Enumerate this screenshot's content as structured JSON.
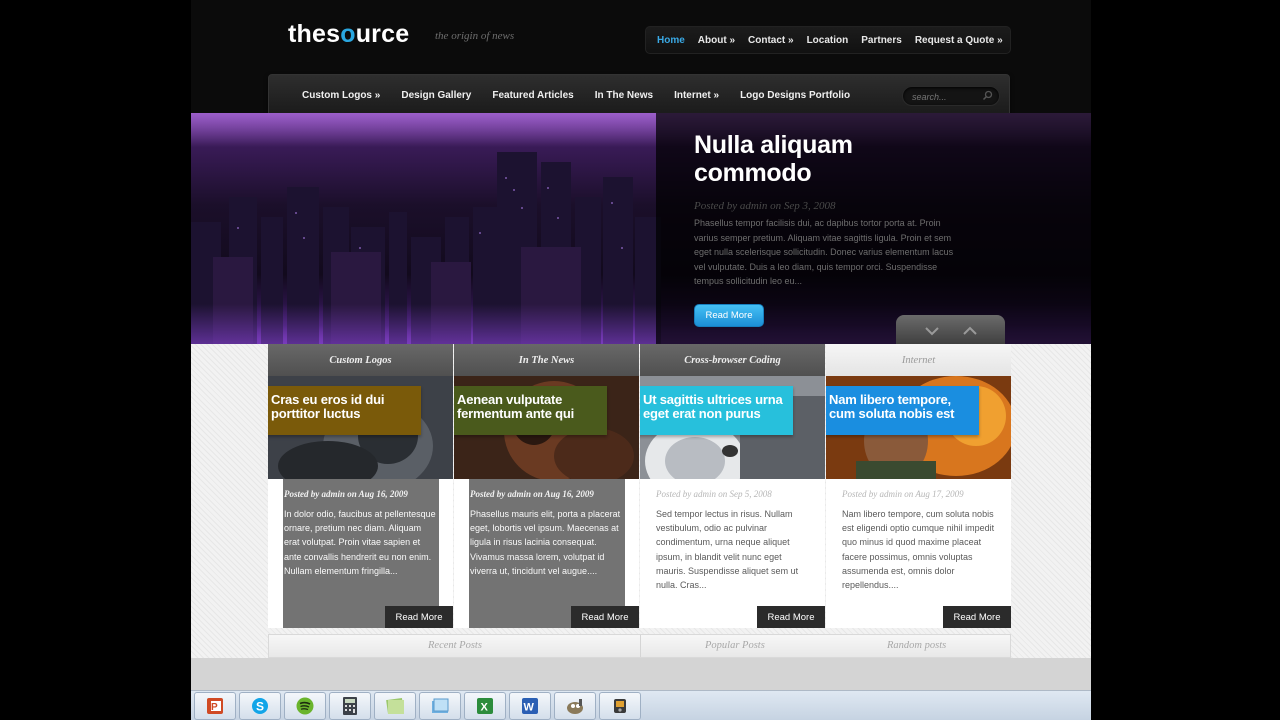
{
  "header": {
    "logo_pre": "thes",
    "logo_o": "o",
    "logo_post": "urce",
    "tagline": "the origin of news",
    "top_nav": [
      "Home",
      "About »",
      "Contact »",
      "Location",
      "Partners",
      "Request a Quote »"
    ],
    "main_nav": [
      "Custom Logos »",
      "Design Gallery",
      "Featured Articles",
      "In The News",
      "Internet »",
      "Logo Designs Portfolio"
    ],
    "search_placeholder": "search..."
  },
  "featured": {
    "title": "Nulla aliquam commodo",
    "meta": "Posted by admin on Sep 3, 2008",
    "excerpt": "Phasellus tempor facilisis dui, ac dapibus tortor porta at. Proin varius semper pretium. Aliquam vitae sagittis ligula. Proin et sem eget nulla scelerisque sollicitudin. Donec varius elementum lacus vel vulputate. Duis a leo diam, quis tempor orci. Suspendisse tempus sollicitudin leo eu...",
    "button": "Read More"
  },
  "cards": [
    {
      "tab": "Custom Logos",
      "label": "Cras eu eros id dui porttitor luctus",
      "label_color": "#7a5a0a",
      "meta": "Posted by admin on Aug 16, 2009",
      "text": "In dolor odio, faucibus at pellentesque ornare, pretium nec diam. Aliquam erat volutpat. Proin vitae sapien et ante convallis hendrerit eu non enim. Nullam elementum fringilla...",
      "button": "Read More"
    },
    {
      "tab": "In The News",
      "label": "Aenean vulputate fermentum ante qui",
      "label_color": "#4a5a1c",
      "meta": "Posted by admin on Aug 16, 2009",
      "text": "Phasellus mauris elit, porta a placerat eget, lobortis vel ipsum. Maecenas at ligula in risus lacinia consequat. Vivamus massa lorem, volutpat id viverra ut, tincidunt vel augue....",
      "button": "Read More"
    },
    {
      "tab": "Cross-browser Coding",
      "label": "Ut sagittis ultrices urna eget erat non purus",
      "label_color": "#27c0dc",
      "meta": "Posted by admin on Sep 5, 2008",
      "text": "Sed tempor lectus in risus. Nullam vestibulum, odio ac pulvinar condimentum, urna neque aliquet ipsum, in blandit velit nunc eget mauris. Suspendisse aliquet sem ut nulla. Cras...",
      "button": "Read More"
    },
    {
      "tab": "Internet",
      "label": "Nam libero tempore, cum soluta nobis est",
      "label_color": "#1a8ee0",
      "meta": "Posted by admin on Aug 17, 2009",
      "text": "Nam libero tempore, cum soluta nobis est eligendi optio cumque nihil impedit quo minus id quod maxime placeat facere possimus, omnis voluptas assumenda est, omnis dolor repellendus....",
      "button": "Read More"
    }
  ],
  "bottom_tabs": [
    "Recent Posts",
    "Popular Posts",
    "Random posts"
  ],
  "taskbar_icons": [
    "powerpoint-icon",
    "skype-icon",
    "spotify-icon",
    "calculator-icon",
    "notes-icon",
    "explorer-icon",
    "excel-icon",
    "word-icon",
    "gimp-icon",
    "media-player-icon"
  ]
}
